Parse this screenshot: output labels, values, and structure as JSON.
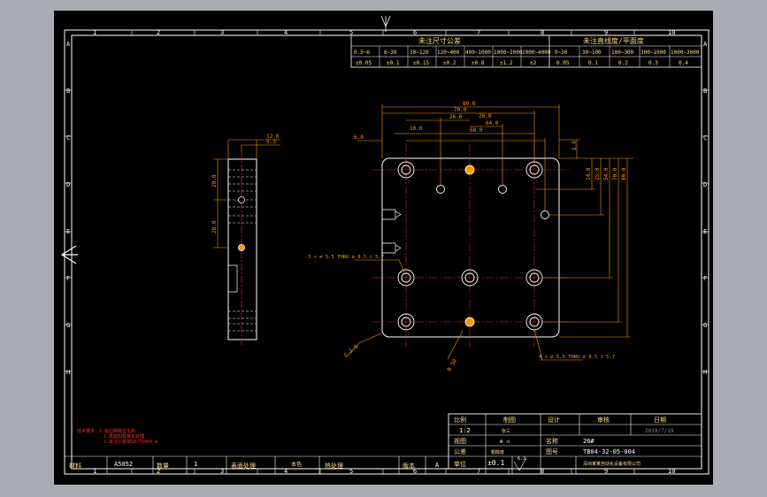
{
  "colors": {
    "background": "#a9acb1",
    "sheet": "#000000",
    "frame": "#ffffff",
    "dimension": "#ff9900",
    "annotation": "#ff2a2a",
    "table_text": "#ffdd88",
    "centerline": "#ff2a2a"
  },
  "border": {
    "columns_top": [
      "1",
      "2",
      "3",
      "4",
      "5",
      "6",
      "7",
      "8",
      "9",
      "10"
    ],
    "columns_bottom": [
      "1",
      "2",
      "3",
      "4",
      "5",
      "6",
      "7",
      "8",
      "9",
      "10"
    ],
    "rows_left": [
      "A",
      "B",
      "C",
      "D",
      "E",
      "F",
      "G",
      "H"
    ],
    "rows_right": [
      "A",
      "B",
      "C",
      "D",
      "E",
      "F",
      "G",
      "H"
    ]
  },
  "tolerance_table": {
    "title_linear": "未注尺寸公差",
    "title_flatness": "未注直线度/平面度",
    "linear_ranges": [
      "0.5~6",
      "6~30",
      "30~120",
      "120~400",
      "400~1000",
      "1000~2000",
      "2000~4000"
    ],
    "linear_values": [
      "±0.05",
      "±0.1",
      "±0.15",
      "±0.2",
      "±0.8",
      "±1.2",
      "±2"
    ],
    "flat_ranges": [
      "0~30",
      "30~100",
      "100~300",
      "300~1000",
      "1000~3000"
    ],
    "flat_values": [
      "0.05",
      "0.1",
      "0.2",
      "0.3",
      "0.4"
    ]
  },
  "side_view_dims": {
    "top_a": "12.0",
    "top_b": "5.3",
    "left_a": "20.0",
    "left_b": "28.0"
  },
  "plan_dims": {
    "d80": "80.0",
    "d70": "70.0",
    "d26a": "26.0",
    "d26b": "26.0",
    "d64": "64.0",
    "d68": "68.0",
    "d10": "10.0",
    "d6": "6.0",
    "d5": "5.0",
    "r14": "14.0",
    "r25": "25.0",
    "r54": "54.0",
    "r70": "70.0",
    "callout_top": "3 × ∅ 5.5 THRU ∅ 9.5 ↧ 5.7",
    "callout_bottom": "4 × ∅ 5.5 THRU ∅ 9.5 ↧ 5.7",
    "chamfer": "C 2.0",
    "radius": "R 50"
  },
  "notes": [
    "技术要求：1.锐边倒钝去毛刺",
    "2.表面阳极氧化处理",
    "3.未注公差按GB/T1804-m"
  ],
  "title_block": {
    "h_scale": "比例",
    "h_drawn": "制图",
    "h_design": "设计",
    "h_check": "审核",
    "h_date": "日期",
    "scale": "1:2",
    "drawn_by": "张三",
    "date": "2019/7/19",
    "view_label": "视图",
    "projection": "⊕ ◁",
    "name_label": "名称",
    "name": "26#",
    "tolerance_label": "公差",
    "tolerance": "±0.1",
    "roughness_label": "粗糙度",
    "roughness": "6.3",
    "dwg_no_label": "图号",
    "dwg_no": "TB04-32-05-004",
    "unit_label": "单位",
    "company": "深圳某某自动化设备有限公司",
    "material_label": "材料",
    "material": "A5052",
    "qty_label": "数量",
    "qty": "1",
    "surface_label": "表面处理",
    "surface": "本色",
    "heat_label": "热处理",
    "heat": "",
    "rev_label": "版本",
    "rev": "A"
  }
}
